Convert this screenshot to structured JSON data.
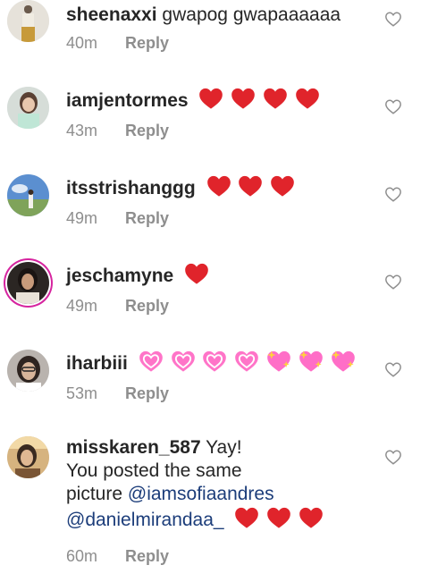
{
  "comments": [
    {
      "username": "sheenaxxi",
      "text": "gwapog gwapaaaaaa",
      "emojis": [],
      "time": "40m",
      "reply": "Reply",
      "avatar": "profile-photo-pale",
      "story_ring": false
    },
    {
      "username": "iamjentormes",
      "text": "",
      "emojis": [
        "red-heart",
        "red-heart",
        "red-heart",
        "red-heart"
      ],
      "time": "43m",
      "reply": "Reply",
      "avatar": "profile-photo-girl-mint",
      "story_ring": false
    },
    {
      "username": "itsstrishanggg",
      "text": "",
      "emojis": [
        "red-heart",
        "red-heart",
        "red-heart"
      ],
      "time": "49m",
      "reply": "Reply",
      "avatar": "profile-photo-sky",
      "story_ring": false
    },
    {
      "username": "jeschamyne",
      "text": "",
      "emojis": [
        "red-heart"
      ],
      "time": "49m",
      "reply": "Reply",
      "avatar": "profile-photo-dark",
      "story_ring": true
    },
    {
      "username": "iharbiii",
      "text": "",
      "emojis": [
        "beating-heart",
        "beating-heart",
        "beating-heart",
        "beating-heart",
        "sparkling-heart",
        "sparkling-heart",
        "sparkling-heart"
      ],
      "time": "53m",
      "reply": "Reply",
      "avatar": "profile-photo-glasses",
      "story_ring": false
    },
    {
      "username": "misskaren_587",
      "text_lines": [
        "Yay!",
        "You posted the same",
        "picture "
      ],
      "mentions": [
        "@iamsofiaandres",
        "@danielmirandaa_"
      ],
      "emojis": [
        "red-heart",
        "red-heart",
        "red-heart"
      ],
      "time": "60m",
      "reply": "Reply",
      "avatar": "profile-photo-warm",
      "story_ring": false
    }
  ],
  "icons": {
    "like": "heart-outline-icon"
  },
  "colors": {
    "username": "#262626",
    "meta": "#8e8e8e",
    "mention": "#1c3d7a",
    "heart_red": "#e0242b",
    "heart_pink": "#ff74c8",
    "story_ring": "#d6249f"
  }
}
